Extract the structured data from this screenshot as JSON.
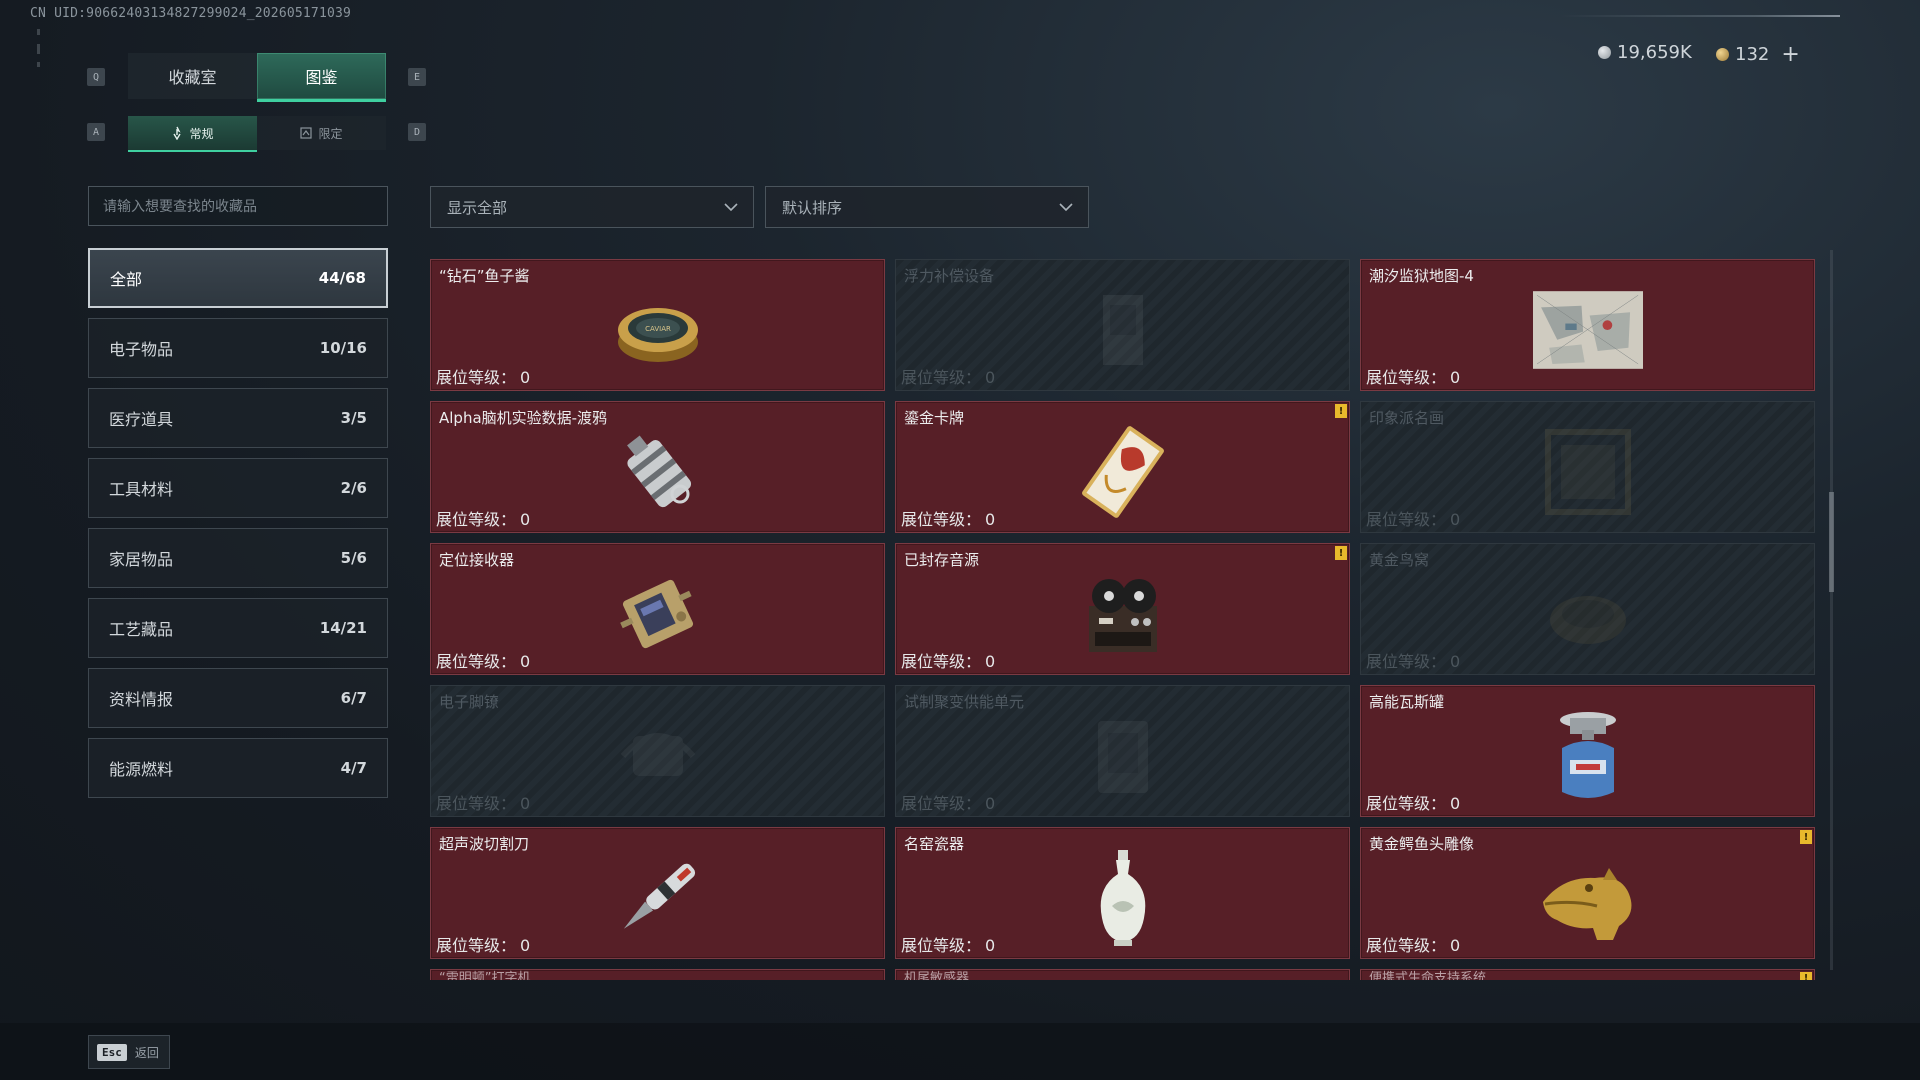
{
  "uid_text": "CN UID:9066240313482729​9024_202605171039",
  "currency": {
    "silver": "19,659K",
    "gold": "132",
    "plus": "+"
  },
  "keys": {
    "q": "Q",
    "e": "E",
    "a": "A",
    "d": "D"
  },
  "tabs": [
    {
      "label": "收藏室",
      "active": false
    },
    {
      "label": "图鉴",
      "active": true
    }
  ],
  "subtabs": [
    {
      "label": "常规",
      "active": true
    },
    {
      "label": "限定",
      "active": false
    }
  ],
  "search": {
    "placeholder": "请输入想要查找的收藏品"
  },
  "filters": {
    "show": "显示全部",
    "sort": "默认排序"
  },
  "categories": [
    {
      "label": "全部",
      "count": "44/68",
      "active": true
    },
    {
      "label": "电子物品",
      "count": "10/16"
    },
    {
      "label": "医疗道具",
      "count": "3/5"
    },
    {
      "label": "工具材料",
      "count": "2/6"
    },
    {
      "label": "家居物品",
      "count": "5/6"
    },
    {
      "label": "工艺藏品",
      "count": "14/21"
    },
    {
      "label": "资料情报",
      "count": "6/7"
    },
    {
      "label": "能源燃料",
      "count": "4/7"
    }
  ],
  "level_label": "展位等级：",
  "items": [
    {
      "name": "“钻石”鱼子酱",
      "level": "0",
      "owned": true,
      "icon": "caviar-tin-icon",
      "flag": false
    },
    {
      "name": "浮力补偿设备",
      "level": "0",
      "owned": false,
      "icon": "buoyancy-device-icon",
      "flag": false
    },
    {
      "name": "潮汐监狱地图-4",
      "level": "0",
      "owned": true,
      "icon": "map-icon",
      "flag": false
    },
    {
      "name": "Alpha脑机实验数据-渡鸦",
      "level": "0",
      "owned": true,
      "icon": "data-canister-icon",
      "flag": false
    },
    {
      "name": "鎏金卡牌",
      "level": "0",
      "owned": true,
      "icon": "gilded-card-icon",
      "flag": true
    },
    {
      "name": "印象派名画",
      "level": "0",
      "owned": false,
      "icon": "painting-icon",
      "flag": false
    },
    {
      "name": "定位接收器",
      "level": "0",
      "owned": true,
      "icon": "receiver-icon",
      "flag": false
    },
    {
      "name": "已封存音源",
      "level": "0",
      "owned": true,
      "icon": "tape-recorder-icon",
      "flag": true
    },
    {
      "name": "黄金鸟窝",
      "level": "0",
      "owned": false,
      "icon": "bird-nest-icon",
      "flag": false
    },
    {
      "name": "电子脚镣",
      "level": "0",
      "owned": false,
      "icon": "ankle-monitor-icon",
      "flag": false
    },
    {
      "name": "试制聚变供能单元",
      "level": "0",
      "owned": false,
      "icon": "fusion-unit-icon",
      "flag": false
    },
    {
      "name": "高能瓦斯罐",
      "level": "0",
      "owned": true,
      "icon": "gas-canister-icon",
      "flag": false
    },
    {
      "name": "超声波切割刀",
      "level": "0",
      "owned": true,
      "icon": "ultrasonic-cutter-icon",
      "flag": false
    },
    {
      "name": "名窑瓷器",
      "level": "0",
      "owned": true,
      "icon": "porcelain-vase-icon",
      "flag": false
    },
    {
      "name": "黄金鳄鱼头雕像",
      "level": "0",
      "owned": true,
      "icon": "gold-crocodile-icon",
      "flag": true
    }
  ],
  "partial_items": [
    {
      "name": "“雷明顿”打字机",
      "flag": false
    },
    {
      "name": "机尾敏感器",
      "flag": false
    },
    {
      "name": "便携式生命支持系统",
      "flag": true
    }
  ],
  "flag_mark": "!",
  "footer": {
    "esc_key": "Esc",
    "back_label": "返回"
  },
  "colors": {
    "owned_card": "#571f27",
    "accent": "#3fd0a0",
    "flag": "#e8b92c"
  }
}
